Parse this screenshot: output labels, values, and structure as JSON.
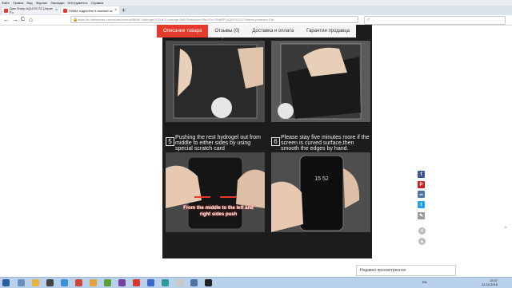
{
  "menubar": [
    "Файл",
    "Правка",
    "Вид",
    "Журнал",
    "Закладки",
    "Инструменты",
    "Справка"
  ],
  "browser": {
    "tabs": [
      {
        "title": "Дом Sharp AQUOS S2 (Japan Fo"
      },
      {
        "title": "ПИМА гидрогель в полный ос"
      }
    ],
    "new_tab": "+",
    "url": "https://ru.aliexpress.com/store/product/IMAK-Hydrogel-3-Full-Coverage-Soft-Protective-Film-For-SHARP-AQUOS-S2-Screen-protector-For-",
    "nav": {
      "back": "←",
      "forward": "→",
      "reload": "C",
      "home": "⌂"
    }
  },
  "page_tabs": [
    {
      "label": "Описание товара",
      "active": true
    },
    {
      "label": "Отзывы (0)",
      "active": false
    },
    {
      "label": "Доставка и оплата",
      "active": false
    },
    {
      "label": "Гарантии продавца",
      "active": false
    }
  ],
  "partial_captions": [
    "lines on the corners)",
    "confirmed"
  ],
  "steps": [
    {
      "num": "5",
      "text": "Pushing the rest hydrogel out from middle to either sides by using special scratch card",
      "overlay": "From the middle to the left and right sides push"
    },
    {
      "num": "6",
      "text": "Please stay five minutes more if the screen is curved surface,then smooth the edges by hand.",
      "phone_time": "15 52"
    }
  ],
  "share": [
    {
      "icon": "facebook-icon",
      "glyph": "f",
      "color": "#3b5998"
    },
    {
      "icon": "pinterest-icon",
      "glyph": "P",
      "color": "#cb2027"
    },
    {
      "icon": "vk-icon",
      "glyph": "vk",
      "color": "#4c75a3"
    },
    {
      "icon": "twitter-icon",
      "glyph": "t",
      "color": "#1da1f2"
    },
    {
      "icon": "edit-icon",
      "glyph": "✎",
      "color": "#9a9a9a"
    }
  ],
  "recent_label": "Недавно просмотренное",
  "taskbar": {
    "lang": "EN",
    "time": "13:37",
    "date": "21.04.2018"
  }
}
